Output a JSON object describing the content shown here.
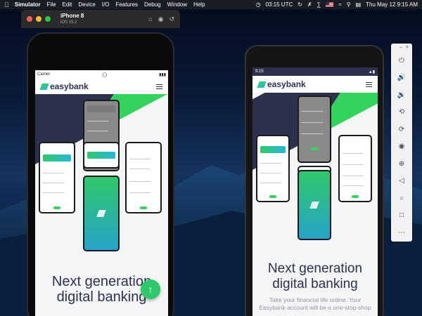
{
  "menubar": {
    "app_name": "Simulator",
    "menus": [
      "File",
      "Edit",
      "Device",
      "I/O",
      "Features",
      "Debug",
      "Window",
      "Help"
    ],
    "time_utc": "03:15 UTC",
    "datetime": "Thu May 12  9:15 AM"
  },
  "simulator": {
    "device_name": "iPhone 8",
    "os_version": "iOS 15.2"
  },
  "ios": {
    "carrier": "Carrier"
  },
  "android": {
    "time": "9:15"
  },
  "app": {
    "logo_text": "easybank",
    "headline_line1": "Next generation",
    "headline_line2": "digital banking",
    "subtext_line1": "Take your financial life online. Your",
    "subtext_line2": "Easybank account will be a one-stop-shop"
  },
  "colors": {
    "brand_dark": "#2d314d",
    "brand_green": "#33d35e",
    "brand_cyan": "#2ab6d9"
  },
  "emulator_controls": [
    "power-icon",
    "volume-up-icon",
    "volume-down-icon",
    "rotate-left-icon",
    "rotate-right-icon",
    "camera-icon",
    "zoom-icon",
    "back-icon",
    "home-icon",
    "overview-icon",
    "more-icon"
  ]
}
